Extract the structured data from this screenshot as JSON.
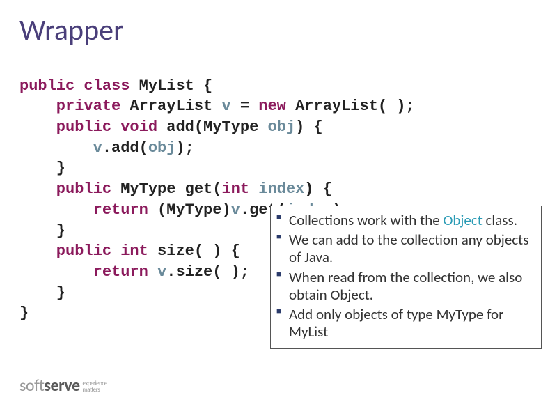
{
  "title": "Wrapper",
  "code": {
    "l1a": "public class",
    "l1b": " MyList {",
    "l2a": "    private",
    "l2b": " ArrayList ",
    "l2c": "v",
    "l2d": " = ",
    "l2e": "new",
    "l2f": " ArrayList( );",
    "l3a": "    public void",
    "l3b": " add(MyType ",
    "l3c": "obj",
    "l3d": ") {",
    "l4a": "        ",
    "l4b": "v",
    "l4c": ".add(",
    "l4d": "obj",
    "l4e": ");",
    "l5": "    }",
    "l6a": "    public",
    "l6b": " MyType get(",
    "l6c": "int",
    "l6d": " ",
    "l6e": "index",
    "l6f": ") {",
    "l7a": "        return",
    "l7b": " (MyType)",
    "l7c": "v",
    "l7d": ".get(",
    "l7e": "index",
    "l7f": ");",
    "l8": "    }",
    "l9a": "    public int",
    "l9b": " size( ) {",
    "l10a": "        return",
    "l10b": " ",
    "l10c": "v",
    "l10d": ".size( );",
    "l11": "    }",
    "l12": "}"
  },
  "info": {
    "item1a": "Collections work with the ",
    "item1b": "Object",
    "item1c": " class.",
    "item2": "We can add to the collection any objects of Java.",
    "item3": "When read from the collection, we also obtain Object.",
    "item4": "Add only objects of type MyType for MyList"
  },
  "logo": {
    "soft": "soft",
    "serve": "serve",
    "tag1": "experience",
    "tag2": "matters"
  }
}
